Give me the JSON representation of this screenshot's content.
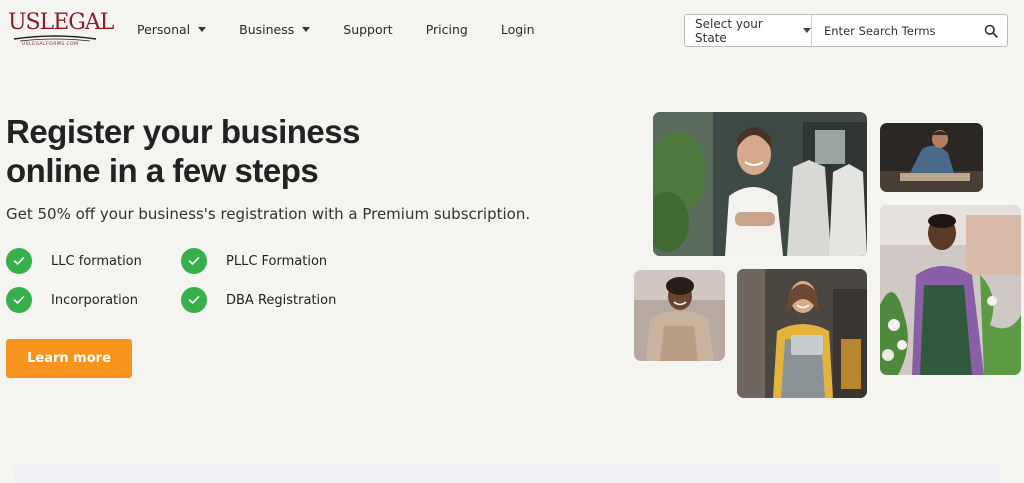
{
  "logo": {
    "text": "USLEGAL",
    "subtext": "USLEGALFORMS.COM"
  },
  "nav": {
    "items": [
      {
        "label": "Personal",
        "dropdown": true
      },
      {
        "label": "Business",
        "dropdown": true
      },
      {
        "label": "Support",
        "dropdown": false
      },
      {
        "label": "Pricing",
        "dropdown": false
      },
      {
        "label": "Login",
        "dropdown": false
      }
    ]
  },
  "search": {
    "state_label": "Select your State",
    "placeholder": "Enter Search Terms"
  },
  "hero": {
    "title_line1": "Register your business",
    "title_line2": "online in a few steps",
    "subtitle": "Get 50% off your business's registration with a Premium subscription.",
    "features": [
      "LLC formation",
      "PLLC Formation",
      "Incorporation",
      "DBA Registration"
    ],
    "cta_label": "Learn more"
  },
  "colors": {
    "brand": "#8c1c23",
    "accent": "#f7941d",
    "check": "#36b04a",
    "background": "#f4f4f1"
  },
  "icons": {
    "search": "search-icon",
    "check": "check-icon",
    "dropdown": "chevron-down-icon"
  }
}
